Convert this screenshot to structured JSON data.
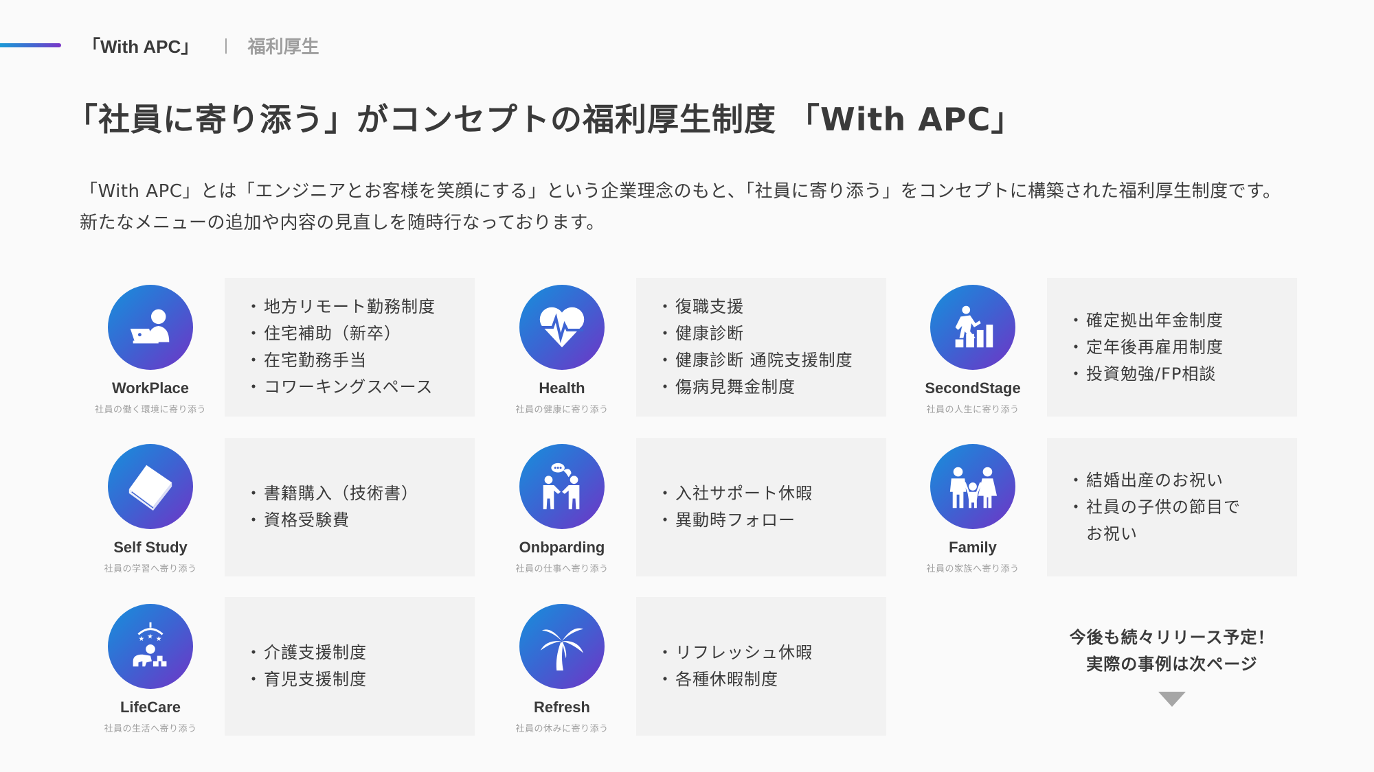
{
  "header": {
    "breadcrumb_primary": "「With APC」",
    "breadcrumb_separator": "|",
    "breadcrumb_secondary": "福利厚生",
    "accent_gradient": [
      "#1a9ad6",
      "#7b35c8"
    ]
  },
  "title": "「社員に寄り添う」がコンセプトの福利厚生制度 「With APC」",
  "lead": "「With APC」とは「エンジニアとお客様を笑顔にする」という企業理念のもと、「社員に寄り添う」をコンセプトに構築された福利厚生制度です。新たなメニューの追加や内容の見直しを随時行なっております。",
  "icon_gradient": [
    "#1690dc",
    "#7034c6"
  ],
  "cards": [
    {
      "name": "WorkPlace",
      "subtitle": "社員の働く環境に寄り添う",
      "icon": "laptop-user-icon",
      "items": [
        "地方リモート勤務制度",
        "住宅補助（新卒）",
        "在宅勤務手当",
        "コワーキングスペース"
      ]
    },
    {
      "name": "Health",
      "subtitle": "社員の健康に寄り添う",
      "icon": "heartbeat-icon",
      "items": [
        "復職支援",
        "健康診断",
        "健康診断 通院支援制度",
        "傷病見舞金制度"
      ]
    },
    {
      "name": "SecondStage",
      "subtitle": "社員の人生に寄り添う",
      "icon": "stairs-climb-icon",
      "items": [
        "確定拠出年金制度",
        "定年後再雇用制度",
        "投資勉強/FP相談"
      ]
    },
    {
      "name": "Self Study",
      "subtitle": "社員の学習へ寄り添う",
      "icon": "book-icon",
      "items": [
        "書籍購入（技術書）",
        "資格受験費"
      ]
    },
    {
      "name": "Onbparding",
      "subtitle": "社員の仕事へ寄り添う",
      "icon": "people-talking-icon",
      "items": [
        "入社サポート休暇",
        "異動時フォロー"
      ]
    },
    {
      "name": "Family",
      "subtitle": "社員の家族へ寄り添う",
      "icon": "family-icon",
      "items": [
        "結婚出産のお祝い",
        "社員の子供の節目で"
      ],
      "continuation": "お祝い"
    },
    {
      "name": "LifeCare",
      "subtitle": "社員の生活へ寄り添う",
      "icon": "baby-crawl-icon",
      "items": [
        "介護支援制度",
        "育児支援制度"
      ]
    },
    {
      "name": "Refresh",
      "subtitle": "社員の休みに寄り添う",
      "icon": "palm-tree-icon",
      "items": [
        "リフレッシュ休暇",
        "各種休暇制度"
      ]
    }
  ],
  "more": {
    "line1": "今後も続々リリース予定！",
    "line2": "実際の事例は次ページ",
    "icon": "down-triangle-icon"
  }
}
